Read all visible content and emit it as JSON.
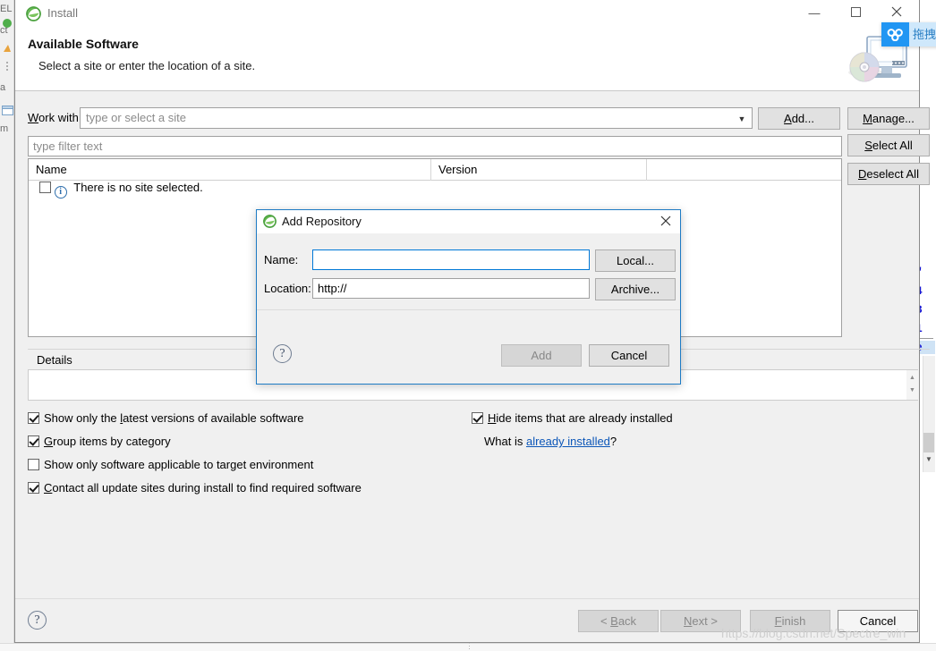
{
  "window": {
    "title": "Install",
    "icon": "eclipse-icon",
    "minimize_label": "—",
    "maximize_label": "☐",
    "close_label": "✕"
  },
  "header": {
    "title": "Available Software",
    "subtitle": "Select a site or enter the location of a site.",
    "graphic": "install-cd-monitor-icon"
  },
  "work_with": {
    "label": "Work with:",
    "label_mnemonic": "W",
    "value": "type or select a site",
    "is_placeholder": true,
    "dropdown_icon": "chevron-down-icon",
    "add_button": "Add...",
    "add_mnemonic": "A",
    "manage_button": "Manage...",
    "manage_mnemonic": "M"
  },
  "filter": {
    "placeholder": "type filter text",
    "value": ""
  },
  "side_buttons": {
    "select_all": "Select All",
    "select_all_mnemonic": "S",
    "deselect_all": "Deselect All",
    "deselect_all_mnemonic": "D"
  },
  "table": {
    "columns": [
      "Name",
      "Version",
      ""
    ],
    "rows": [
      {
        "name": "There is no site selected.",
        "version": "",
        "checked": false,
        "icon": "info-icon"
      }
    ]
  },
  "details": {
    "group_label": "Details",
    "content": ""
  },
  "options": {
    "left": [
      {
        "label_before": "Show only the ",
        "mnemonic": "l",
        "label_after": "atest versions of available software",
        "checked": true
      },
      {
        "label_before": "",
        "mnemonic": "G",
        "label_after": "roup items by category",
        "checked": true
      },
      {
        "label_before": "Show only software applicable to target environment",
        "mnemonic": "",
        "label_after": "",
        "checked": false
      },
      {
        "label_before": "",
        "mnemonic": "C",
        "label_after": "ontact all update sites during install to find required software",
        "checked": true
      }
    ],
    "right": {
      "hide_installed": {
        "label_before": "",
        "mnemonic": "H",
        "label_after": "ide items that are already installed",
        "checked": true
      },
      "what_is_prefix": "What is ",
      "what_is_link": "already installed",
      "what_is_suffix": "?"
    }
  },
  "footer": {
    "help_icon": "help-question-icon",
    "back": "< Back",
    "back_mnemonic": "B",
    "next": "Next >",
    "next_mnemonic": "N",
    "finish": "Finish",
    "finish_mnemonic": "F",
    "cancel": "Cancel",
    "back_disabled": true,
    "next_disabled": true,
    "finish_disabled": true
  },
  "dialog": {
    "title": "Add Repository",
    "icon": "eclipse-icon",
    "close_label": "✕",
    "name_label": "Name:",
    "name_value": "",
    "location_label": "Location:",
    "location_value": "http://",
    "local_button": "Local...",
    "archive_button": "Archive...",
    "add_button": "Add",
    "add_disabled": true,
    "cancel_button": "Cancel",
    "help_icon": "help-question-icon"
  },
  "overlay": {
    "badge_icon": "baidu-netdisk-icon",
    "text": "拖拽"
  },
  "watermark": "https://blog.csdn.net/Spectre_win",
  "background": {
    "left_fragments": [
      "EL",
      "ct",
      "a",
      "m"
    ],
    "right_fragments": [
      "\"",
      "4",
      "3",
      "1",
      "e"
    ]
  },
  "colors": {
    "accent": "#0078d7",
    "link": "#0b56b8",
    "dialog_border": "#1e7bc4",
    "baidu_blue": "#2196f3",
    "window_bg": "#f0f0f0",
    "info_blue": "#2f6fad"
  }
}
